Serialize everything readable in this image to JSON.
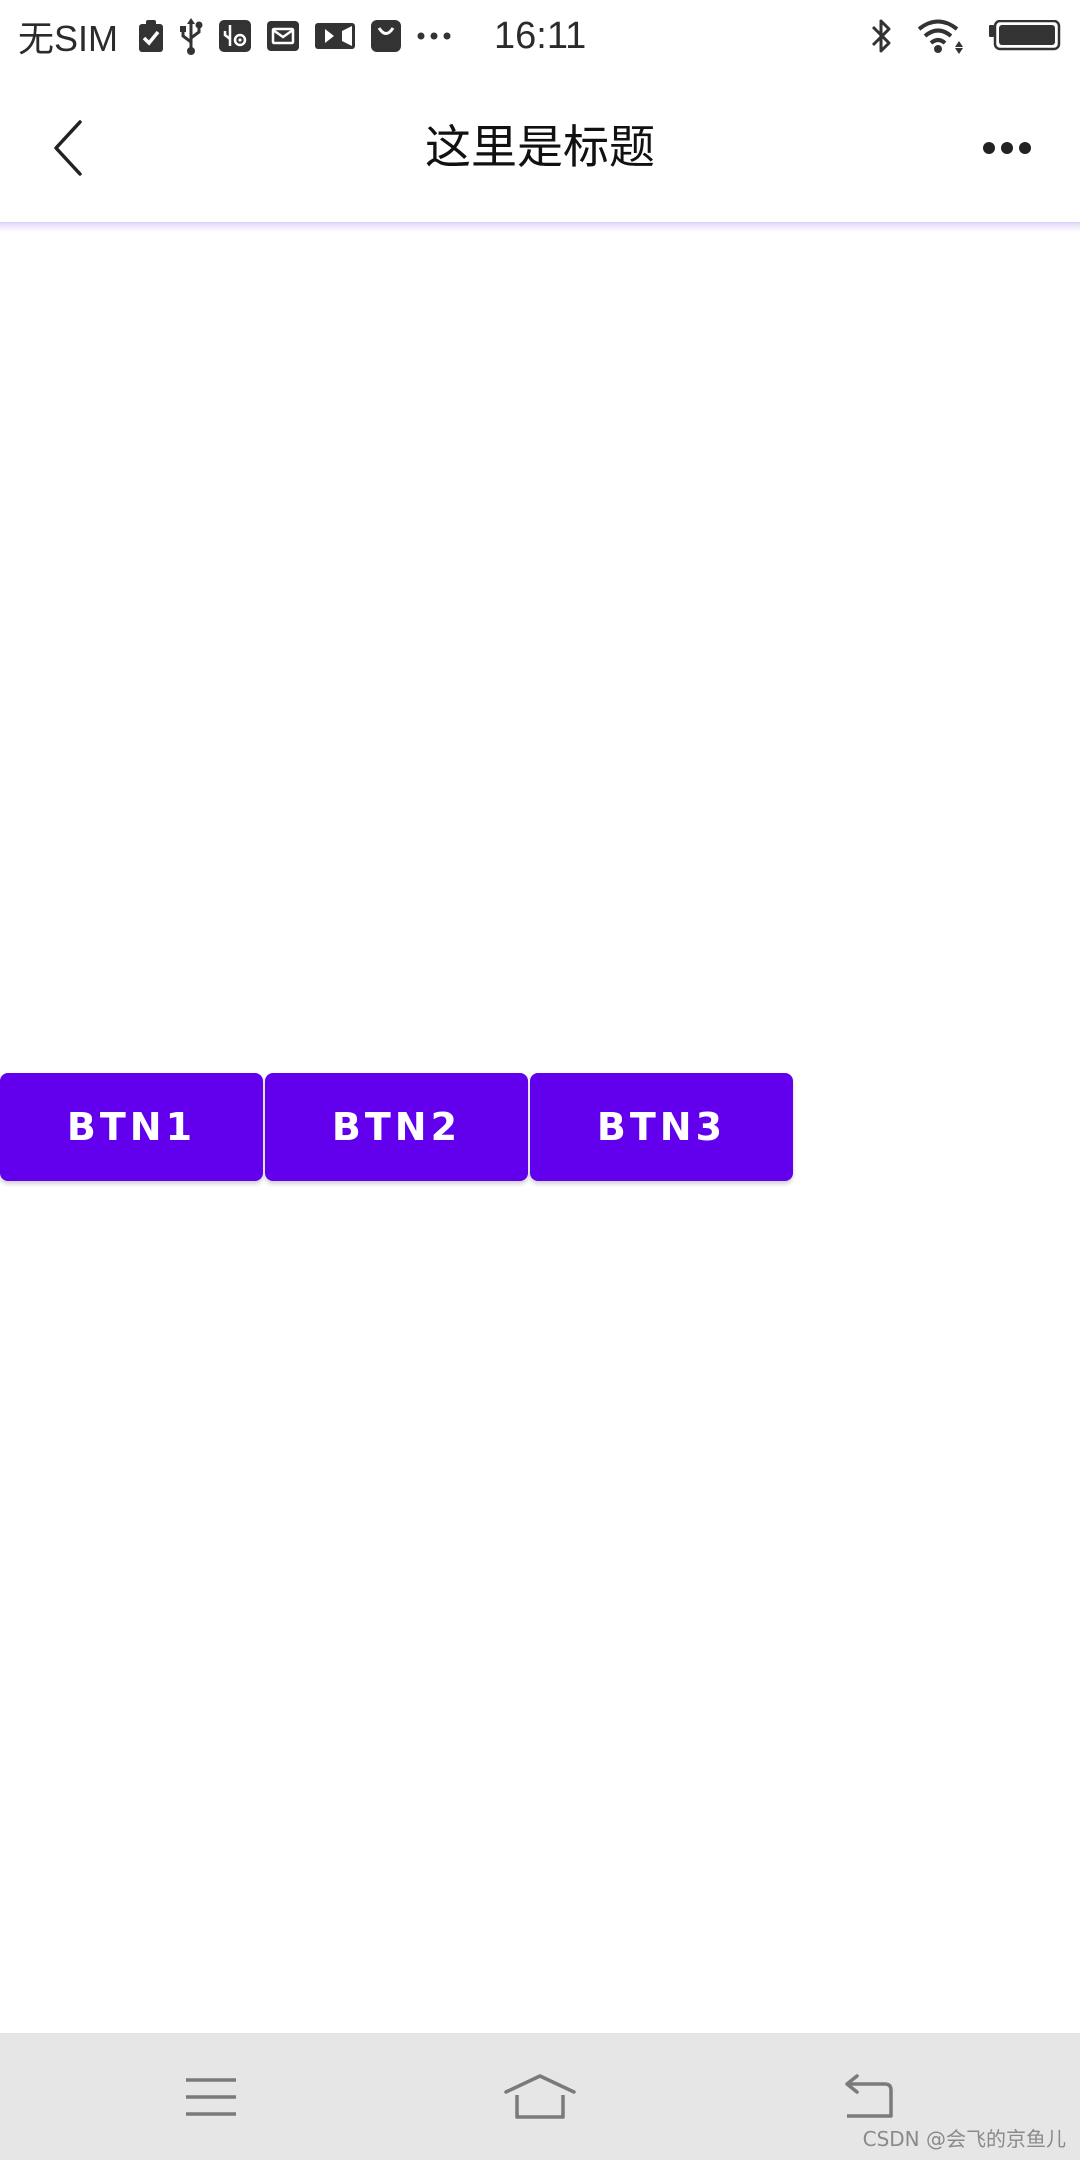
{
  "status_bar": {
    "carrier": "无SIM",
    "time": "16:11",
    "left_icons": [
      "clipboard-check-icon",
      "usb-icon",
      "usb-debug-icon",
      "mail-icon",
      "video-icon",
      "shopping-bag-icon",
      "more-dots-icon"
    ],
    "right_icons": [
      "bluetooth-icon",
      "wifi-icon",
      "battery-icon"
    ]
  },
  "app_bar": {
    "title": "这里是标题",
    "back_icon": "back-chevron-icon",
    "more_icon": "more-horizontal-icon"
  },
  "buttons": [
    {
      "label": "BTN1"
    },
    {
      "label": "BTN2"
    },
    {
      "label": "BTN3"
    }
  ],
  "nav_bar": {
    "icons": [
      "menu-icon",
      "home-icon",
      "back-icon"
    ]
  },
  "watermark": "CSDN @会飞的京鱼儿",
  "colors": {
    "accent": "#6200ee",
    "nav_background": "#e6e6e6",
    "app_bar_divider": "#ddd0f6"
  }
}
